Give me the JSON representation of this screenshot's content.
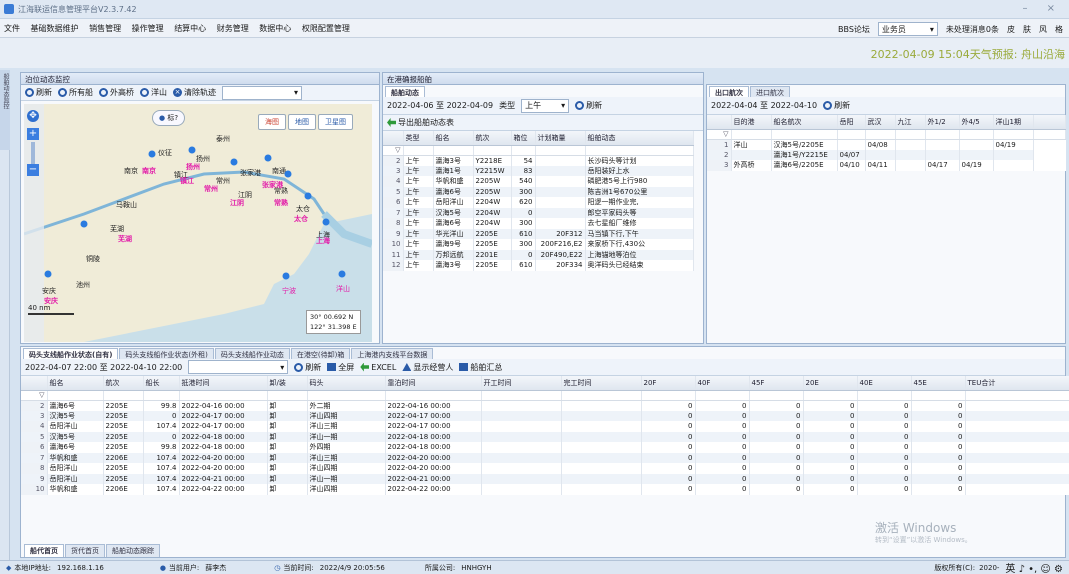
{
  "app": {
    "title": "江海联运信息管理平台V2.3.7.42",
    "window_controls": "– ×"
  },
  "menu": [
    "文件",
    "基础数据维护",
    "销售管理",
    "操作管理",
    "结算中心",
    "财务管理",
    "数据中心",
    "权限配置管理"
  ],
  "menu_right": {
    "forum": "BBS论坛",
    "role": "业务员",
    "notice": "未处理消息0条",
    "theme": "皮",
    "skin": "肤",
    "wind": "风",
    "style": "格"
  },
  "banner": "2022-04-09  15:04天气预报:  舟山沿海",
  "side_tab": "船舶动态监控",
  "left_panel": {
    "title": "泊位动态监控",
    "toolbar": [
      "刷新",
      "所有船",
      "外高桥",
      "洋山",
      "清除轨迹"
    ],
    "map_labels": [
      "泰州",
      "仪征",
      "扬州",
      "南京",
      "镇江",
      "常州",
      "张家港",
      "南通",
      "江阴",
      "常熟",
      "太仓",
      "马鞍山",
      "芜湖",
      "铜陵",
      "池州",
      "安庆",
      "上海",
      "洋山",
      "宁波"
    ],
    "map_pink_labels": [
      "扬州",
      "南京",
      "镇江",
      "常州",
      "张家港",
      "常熟",
      "太仓",
      "芜湖",
      "安庆",
      "江阴",
      "上海"
    ],
    "map_btns": [
      "标?",
      "海图",
      "地图",
      "卫星图"
    ],
    "scale": "40 nm",
    "coord1": "30° 00.692 N",
    "coord2": "122° 31.398 E"
  },
  "mid_panel": {
    "title": "在港确报船舶",
    "tab": "船舶动态",
    "date_range": "2022-04-06 至 2022-04-09",
    "type_label": "类型",
    "type_value": "上午",
    "refresh": "刷新",
    "export": "导出船舶动态表",
    "headers": [
      "类型",
      "船名",
      "航次",
      "箱位",
      "计划箱量",
      "船舶动态"
    ],
    "rows": [
      [
        "2",
        "上午",
        "瀛海3号",
        "Y2218E",
        "54",
        "",
        "长沙码头等计划"
      ],
      [
        "3",
        "上午",
        "瀛海1号",
        "Y2215W",
        "83",
        "",
        "岳阳装好上水"
      ],
      [
        "4",
        "上午",
        "华帆和盛",
        "2205W",
        "540",
        "",
        "磷肥港5号上行980"
      ],
      [
        "5",
        "上午",
        "瀛海6号",
        "2205W",
        "300",
        "",
        "陈吉洲1号670公里"
      ],
      [
        "6",
        "上午",
        "岳阳洋山",
        "2204W",
        "620",
        "",
        "阳逻一期作业完,"
      ],
      [
        "7",
        "上午",
        "汉海5号",
        "2204W",
        "0",
        "",
        "郎空平家码头等"
      ],
      [
        "8",
        "上午",
        "瀛海6号",
        "2204W",
        "300",
        "",
        "去七星船厂维修"
      ],
      [
        "9",
        "上午",
        "华光洋山",
        "2205E",
        "610",
        "20F312",
        "马当镇下行,下午"
      ],
      [
        "10",
        "上午",
        "瀛海9号",
        "2205E",
        "300",
        "200F216,E2",
        "来家桥下行,430公"
      ],
      [
        "11",
        "上午",
        "万邦远航",
        "2201E",
        "0",
        "20F490,E22",
        "上海锚地等泊位"
      ],
      [
        "12",
        "上午",
        "瀛海3号",
        "2205E",
        "610",
        "20F334",
        "奥洋码头已经结束"
      ]
    ]
  },
  "right_panel": {
    "tabs": [
      "出口航次",
      "进口航次"
    ],
    "date_range": "2022-04-04 至 2022-04-10",
    "refresh": "刷新",
    "headers": [
      "目的港",
      "船名航次",
      "岳阳",
      "武汉",
      "九江",
      "外1/2",
      "外4/5",
      "洋山1期"
    ],
    "rows": [
      [
        "1",
        "洋山",
        "汉海5号/2205E",
        "",
        "04/08",
        "",
        "",
        "",
        "04/19"
      ],
      [
        "2",
        "",
        "瀛海1号/Y2215E",
        "04/07",
        "",
        "",
        "",
        "",
        ""
      ],
      [
        "3",
        "外高桥",
        "瀛海6号/2205E",
        "04/10",
        "04/11",
        "",
        "04/17",
        "04/19",
        ""
      ]
    ]
  },
  "bottom_panel": {
    "tabs": [
      "码头支线船作业状态(自有)",
      "码头支线船作业状态(外租)",
      "码头支线船作业动态",
      "在港空(待卸)箱",
      "上海港内支线平台数据"
    ],
    "date_range": "2022-04-07 22:00 至 2022-04-10 22:00",
    "buttons": [
      "刷新",
      "全屏",
      "EXCEL",
      "显示经营人",
      "船舶汇总"
    ],
    "headers": [
      "船名",
      "航次",
      "船长",
      "抵港时间",
      "卸/装",
      "码头",
      "靠泊时间",
      "开工时间",
      "完工时间",
      "20F",
      "40F",
      "45F",
      "20E",
      "40E",
      "45E",
      "TEU合计"
    ],
    "rows": [
      [
        "2",
        "瀛海6号",
        "2205E",
        "99.8",
        "2022-04-16 00:00",
        "卸",
        "外二期",
        "2022-04-16 00:00",
        "",
        "",
        "0",
        "0",
        "0",
        "0",
        "0",
        "0",
        "0"
      ],
      [
        "3",
        "汉海5号",
        "2205E",
        "0",
        "2022-04-17 00:00",
        "卸",
        "洋山四期",
        "2022-04-17 00:00",
        "",
        "",
        "0",
        "0",
        "0",
        "0",
        "0",
        "0",
        "0"
      ],
      [
        "4",
        "岳阳洋山",
        "2205E",
        "107.4",
        "2022-04-17 00:00",
        "卸",
        "洋山三期",
        "2022-04-17 00:00",
        "",
        "",
        "0",
        "0",
        "0",
        "0",
        "0",
        "0",
        "0"
      ],
      [
        "5",
        "汉海5号",
        "2205E",
        "0",
        "2022-04-18 00:00",
        "卸",
        "洋山一期",
        "2022-04-18 00:00",
        "",
        "",
        "0",
        "0",
        "0",
        "0",
        "0",
        "0",
        "0"
      ],
      [
        "6",
        "瀛海6号",
        "2205E",
        "99.8",
        "2022-04-18 00:00",
        "卸",
        "外四期",
        "2022-04-18 00:00",
        "",
        "",
        "0",
        "0",
        "0",
        "0",
        "0",
        "0",
        "0"
      ],
      [
        "7",
        "华帆和盛",
        "2206E",
        "107.4",
        "2022-04-20 00:00",
        "卸",
        "洋山三期",
        "2022-04-20 00:00",
        "",
        "",
        "0",
        "0",
        "0",
        "0",
        "0",
        "0",
        "0"
      ],
      [
        "8",
        "岳阳洋山",
        "2205E",
        "107.4",
        "2022-04-20 00:00",
        "卸",
        "洋山四期",
        "2022-04-20 00:00",
        "",
        "",
        "0",
        "0",
        "0",
        "0",
        "0",
        "0",
        "0"
      ],
      [
        "9",
        "岳阳洋山",
        "2205E",
        "107.4",
        "2022-04-21 00:00",
        "卸",
        "洋山一期",
        "2022-04-21 00:00",
        "",
        "",
        "0",
        "0",
        "0",
        "0",
        "0",
        "0",
        "0"
      ],
      [
        "10",
        "华帆和盛",
        "2206E",
        "107.4",
        "2022-04-22 00:00",
        "卸",
        "洋山四期",
        "2022-04-22 00:00",
        "",
        "",
        "0",
        "0",
        "0",
        "0",
        "0",
        "0",
        "0"
      ]
    ],
    "footer_tabs": [
      "船代首页",
      "货代首页",
      "船舶动态跟踪"
    ]
  },
  "watermark": {
    "line1": "激活 Windows",
    "line2": "转到“设置”以激活 Windows。"
  },
  "status": {
    "ip_label": "本地IP地址:",
    "ip": "192.168.1.16",
    "user_label": "当前用户:",
    "user": "薛李杰",
    "time_label": "当前时间:",
    "time": "2022/4/9 20:05:56",
    "company_label": "所属公司:",
    "company": "HNHGYH",
    "copyright": "版权所有(C):",
    "year": "2020-",
    "ime": "英 ♪ •, ☺ ⚙"
  }
}
